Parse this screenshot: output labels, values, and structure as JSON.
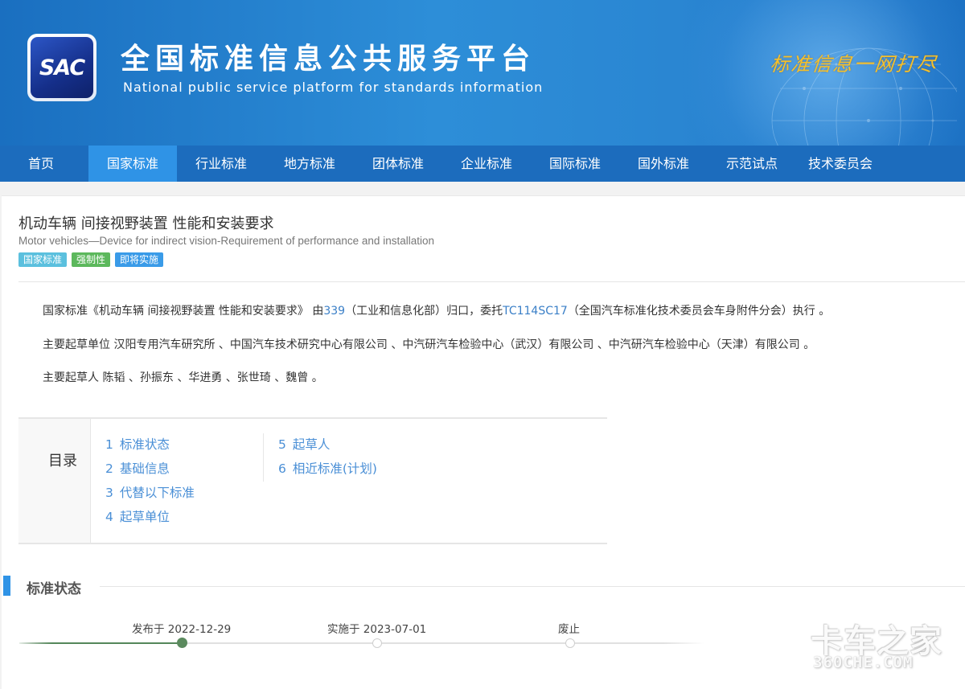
{
  "header": {
    "logo_text": "SAC",
    "title": "全国标准信息公共服务平台",
    "subtitle": "National public service platform  for standards information",
    "slogan": "标准信息一网打尽"
  },
  "nav": {
    "items": [
      {
        "label": "首页",
        "active": false
      },
      {
        "label": "国家标准",
        "active": true
      },
      {
        "label": "行业标准",
        "active": false
      },
      {
        "label": "地方标准",
        "active": false
      },
      {
        "label": "团体标准",
        "active": false
      },
      {
        "label": "企业标准",
        "active": false
      },
      {
        "label": "国际标准",
        "active": false
      },
      {
        "label": "国外标准",
        "active": false
      },
      {
        "label": "示范试点",
        "active": false
      },
      {
        "label": "技术委员会",
        "active": false
      }
    ]
  },
  "standard": {
    "title_cn": "机动车辆 间接视野装置 性能和安装要求",
    "title_en": "Motor vehicles—Device for indirect vision-Requirement of performance and installation",
    "tags": [
      {
        "label": "国家标准",
        "color": "#5bc0de"
      },
      {
        "label": "强制性",
        "color": "#5cb85c"
      },
      {
        "label": "即将实施",
        "color": "#3a9be8"
      }
    ]
  },
  "summary": {
    "p1_prefix": "国家标准《机动车辆 间接视野装置 性能和安装要求》 由",
    "p1_link1": "339",
    "p1_mid": "（工业和信息化部）归口，委托",
    "p1_link2": "TC114SC17",
    "p1_suffix": "（全国汽车标准化技术委员会车身附件分会）执行 。",
    "p2": "主要起草单位 汉阳专用汽车研究所 、中国汽车技术研究中心有限公司 、中汽研汽车检验中心（武汉）有限公司 、中汽研汽车检验中心（天津）有限公司 。",
    "p3": "主要起草人 陈韬 、孙振东 、华进勇 、张世琦 、魏曾 。"
  },
  "toc": {
    "label": "目录",
    "items": [
      {
        "num": "1",
        "label": "标准状态"
      },
      {
        "num": "2",
        "label": "基础信息"
      },
      {
        "num": "3",
        "label": "代替以下标准"
      },
      {
        "num": "4",
        "label": "起草单位"
      },
      {
        "num": "5",
        "label": "起草人"
      },
      {
        "num": "6",
        "label": "相近标准(计划)"
      }
    ]
  },
  "status_section": {
    "title": "标准状态",
    "timeline": [
      {
        "label": "发布于 2022-12-29",
        "done": true
      },
      {
        "label": "实施于 2023-07-01",
        "done": false
      },
      {
        "label": "废止",
        "done": false
      }
    ]
  },
  "watermark": {
    "cn": "卡车之家",
    "en": "360CHE.COM"
  },
  "colors": {
    "nav_bg": "#1c6cbd",
    "nav_active": "#2f93e6",
    "link": "#3a7fc7",
    "toc_link": "#4a8fd6",
    "timeline_done": "#5b8a5e",
    "slogan": "#f6c12a"
  }
}
